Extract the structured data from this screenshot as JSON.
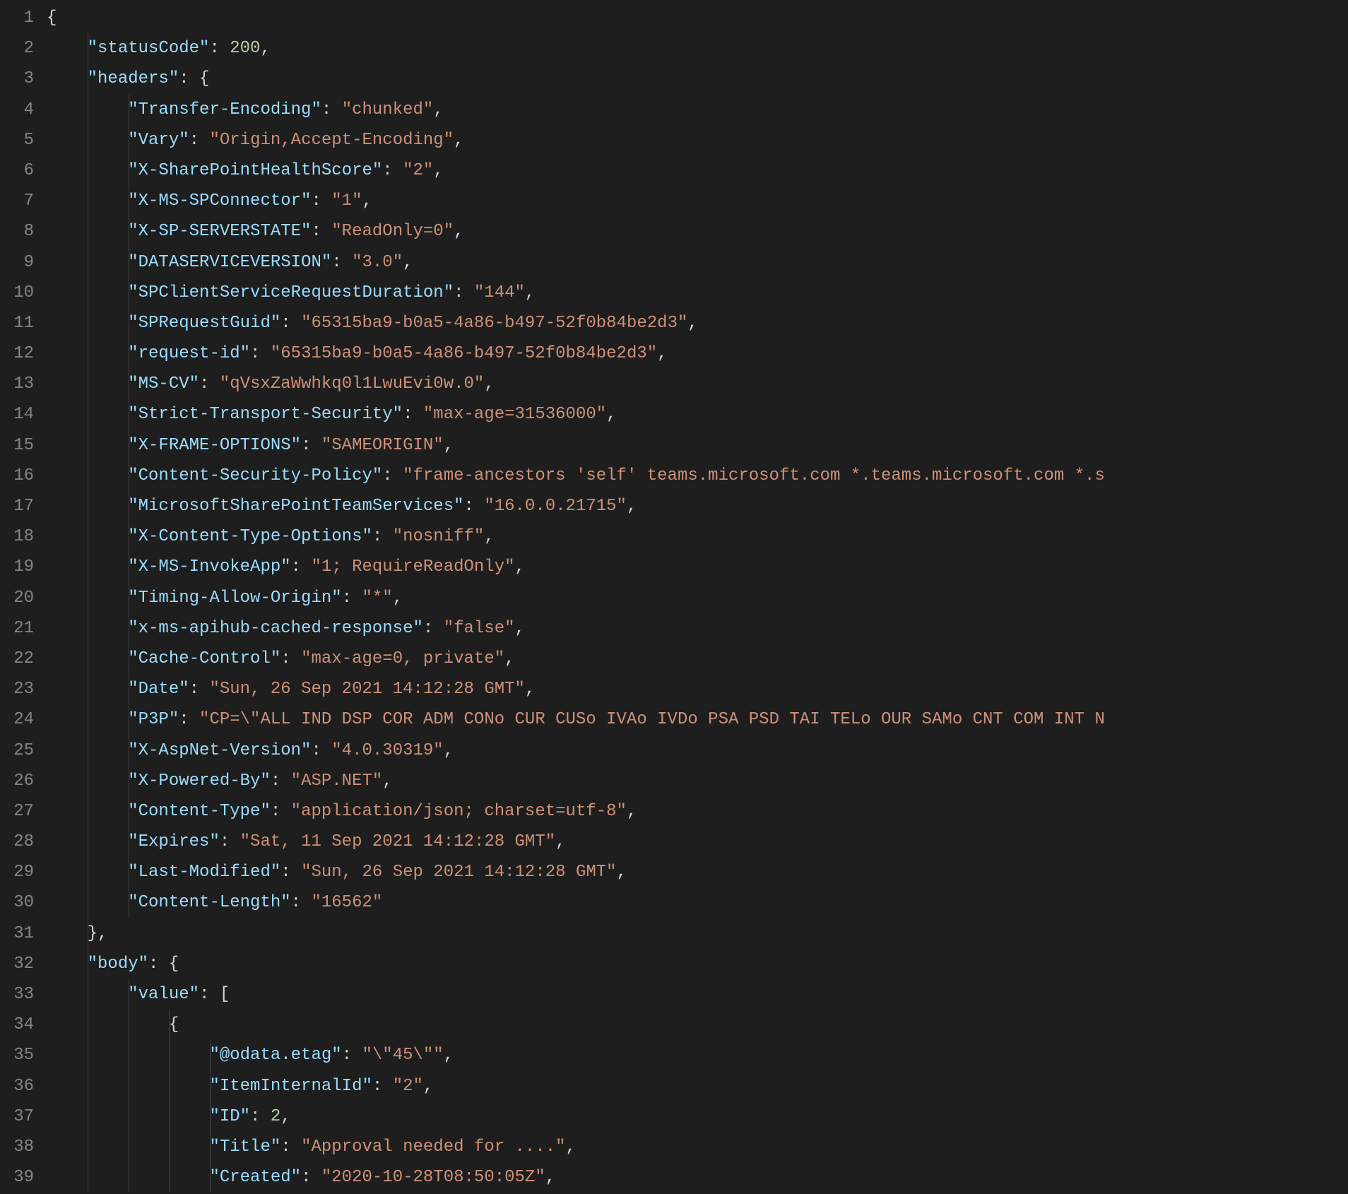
{
  "lines": [
    {
      "n": 1,
      "indent": 0,
      "guides": [],
      "tokens": [
        {
          "t": "brace",
          "v": "{"
        }
      ]
    },
    {
      "n": 2,
      "indent": 1,
      "guides": [
        1
      ],
      "tokens": [
        {
          "t": "key",
          "v": "\"statusCode\""
        },
        {
          "t": "punct",
          "v": ": "
        },
        {
          "t": "num",
          "v": "200"
        },
        {
          "t": "punct",
          "v": ","
        }
      ]
    },
    {
      "n": 3,
      "indent": 1,
      "guides": [
        1
      ],
      "tokens": [
        {
          "t": "key",
          "v": "\"headers\""
        },
        {
          "t": "punct",
          "v": ": "
        },
        {
          "t": "brace",
          "v": "{"
        }
      ]
    },
    {
      "n": 4,
      "indent": 2,
      "guides": [
        1,
        2
      ],
      "tokens": [
        {
          "t": "key",
          "v": "\"Transfer-Encoding\""
        },
        {
          "t": "punct",
          "v": ": "
        },
        {
          "t": "str",
          "v": "\"chunked\""
        },
        {
          "t": "punct",
          "v": ","
        }
      ]
    },
    {
      "n": 5,
      "indent": 2,
      "guides": [
        1,
        2
      ],
      "tokens": [
        {
          "t": "key",
          "v": "\"Vary\""
        },
        {
          "t": "punct",
          "v": ": "
        },
        {
          "t": "str",
          "v": "\"Origin,Accept-Encoding\""
        },
        {
          "t": "punct",
          "v": ","
        }
      ]
    },
    {
      "n": 6,
      "indent": 2,
      "guides": [
        1,
        2
      ],
      "tokens": [
        {
          "t": "key",
          "v": "\"X-SharePointHealthScore\""
        },
        {
          "t": "punct",
          "v": ": "
        },
        {
          "t": "str",
          "v": "\"2\""
        },
        {
          "t": "punct",
          "v": ","
        }
      ]
    },
    {
      "n": 7,
      "indent": 2,
      "guides": [
        1,
        2
      ],
      "tokens": [
        {
          "t": "key",
          "v": "\"X-MS-SPConnector\""
        },
        {
          "t": "punct",
          "v": ": "
        },
        {
          "t": "str",
          "v": "\"1\""
        },
        {
          "t": "punct",
          "v": ","
        }
      ]
    },
    {
      "n": 8,
      "indent": 2,
      "guides": [
        1,
        2
      ],
      "tokens": [
        {
          "t": "key",
          "v": "\"X-SP-SERVERSTATE\""
        },
        {
          "t": "punct",
          "v": ": "
        },
        {
          "t": "str",
          "v": "\"ReadOnly=0\""
        },
        {
          "t": "punct",
          "v": ","
        }
      ]
    },
    {
      "n": 9,
      "indent": 2,
      "guides": [
        1,
        2
      ],
      "tokens": [
        {
          "t": "key",
          "v": "\"DATASERVICEVERSION\""
        },
        {
          "t": "punct",
          "v": ": "
        },
        {
          "t": "str",
          "v": "\"3.0\""
        },
        {
          "t": "punct",
          "v": ","
        }
      ]
    },
    {
      "n": 10,
      "indent": 2,
      "guides": [
        1,
        2
      ],
      "tokens": [
        {
          "t": "key",
          "v": "\"SPClientServiceRequestDuration\""
        },
        {
          "t": "punct",
          "v": ": "
        },
        {
          "t": "str",
          "v": "\"144\""
        },
        {
          "t": "punct",
          "v": ","
        }
      ]
    },
    {
      "n": 11,
      "indent": 2,
      "guides": [
        1,
        2
      ],
      "tokens": [
        {
          "t": "key",
          "v": "\"SPRequestGuid\""
        },
        {
          "t": "punct",
          "v": ": "
        },
        {
          "t": "str",
          "v": "\"65315ba9-b0a5-4a86-b497-52f0b84be2d3\""
        },
        {
          "t": "punct",
          "v": ","
        }
      ]
    },
    {
      "n": 12,
      "indent": 2,
      "guides": [
        1,
        2
      ],
      "tokens": [
        {
          "t": "key",
          "v": "\"request-id\""
        },
        {
          "t": "punct",
          "v": ": "
        },
        {
          "t": "str",
          "v": "\"65315ba9-b0a5-4a86-b497-52f0b84be2d3\""
        },
        {
          "t": "punct",
          "v": ","
        }
      ]
    },
    {
      "n": 13,
      "indent": 2,
      "guides": [
        1,
        2
      ],
      "tokens": [
        {
          "t": "key",
          "v": "\"MS-CV\""
        },
        {
          "t": "punct",
          "v": ": "
        },
        {
          "t": "str",
          "v": "\"qVsxZaWwhkq0l1LwuEvi0w.0\""
        },
        {
          "t": "punct",
          "v": ","
        }
      ]
    },
    {
      "n": 14,
      "indent": 2,
      "guides": [
        1,
        2
      ],
      "tokens": [
        {
          "t": "key",
          "v": "\"Strict-Transport-Security\""
        },
        {
          "t": "punct",
          "v": ": "
        },
        {
          "t": "str",
          "v": "\"max-age=31536000\""
        },
        {
          "t": "punct",
          "v": ","
        }
      ]
    },
    {
      "n": 15,
      "indent": 2,
      "guides": [
        1,
        2
      ],
      "tokens": [
        {
          "t": "key",
          "v": "\"X-FRAME-OPTIONS\""
        },
        {
          "t": "punct",
          "v": ": "
        },
        {
          "t": "str",
          "v": "\"SAMEORIGIN\""
        },
        {
          "t": "punct",
          "v": ","
        }
      ]
    },
    {
      "n": 16,
      "indent": 2,
      "guides": [
        1,
        2
      ],
      "tokens": [
        {
          "t": "key",
          "v": "\"Content-Security-Policy\""
        },
        {
          "t": "punct",
          "v": ": "
        },
        {
          "t": "str",
          "v": "\"frame-ancestors 'self' teams.microsoft.com *.teams.microsoft.com *.s"
        }
      ]
    },
    {
      "n": 17,
      "indent": 2,
      "guides": [
        1,
        2
      ],
      "tokens": [
        {
          "t": "key",
          "v": "\"MicrosoftSharePointTeamServices\""
        },
        {
          "t": "punct",
          "v": ": "
        },
        {
          "t": "str",
          "v": "\"16.0.0.21715\""
        },
        {
          "t": "punct",
          "v": ","
        }
      ]
    },
    {
      "n": 18,
      "indent": 2,
      "guides": [
        1,
        2
      ],
      "tokens": [
        {
          "t": "key",
          "v": "\"X-Content-Type-Options\""
        },
        {
          "t": "punct",
          "v": ": "
        },
        {
          "t": "str",
          "v": "\"nosniff\""
        },
        {
          "t": "punct",
          "v": ","
        }
      ]
    },
    {
      "n": 19,
      "indent": 2,
      "guides": [
        1,
        2
      ],
      "tokens": [
        {
          "t": "key",
          "v": "\"X-MS-InvokeApp\""
        },
        {
          "t": "punct",
          "v": ": "
        },
        {
          "t": "str",
          "v": "\"1; RequireReadOnly\""
        },
        {
          "t": "punct",
          "v": ","
        }
      ]
    },
    {
      "n": 20,
      "indent": 2,
      "guides": [
        1,
        2
      ],
      "tokens": [
        {
          "t": "key",
          "v": "\"Timing-Allow-Origin\""
        },
        {
          "t": "punct",
          "v": ": "
        },
        {
          "t": "str",
          "v": "\"*\""
        },
        {
          "t": "punct",
          "v": ","
        }
      ]
    },
    {
      "n": 21,
      "indent": 2,
      "guides": [
        1,
        2
      ],
      "tokens": [
        {
          "t": "key",
          "v": "\"x-ms-apihub-cached-response\""
        },
        {
          "t": "punct",
          "v": ": "
        },
        {
          "t": "str",
          "v": "\"false\""
        },
        {
          "t": "punct",
          "v": ","
        }
      ]
    },
    {
      "n": 22,
      "indent": 2,
      "guides": [
        1,
        2
      ],
      "tokens": [
        {
          "t": "key",
          "v": "\"Cache-Control\""
        },
        {
          "t": "punct",
          "v": ": "
        },
        {
          "t": "str",
          "v": "\"max-age=0, private\""
        },
        {
          "t": "punct",
          "v": ","
        }
      ]
    },
    {
      "n": 23,
      "indent": 2,
      "guides": [
        1,
        2
      ],
      "tokens": [
        {
          "t": "key",
          "v": "\"Date\""
        },
        {
          "t": "punct",
          "v": ": "
        },
        {
          "t": "str",
          "v": "\"Sun, 26 Sep 2021 14:12:28 GMT\""
        },
        {
          "t": "punct",
          "v": ","
        }
      ]
    },
    {
      "n": 24,
      "indent": 2,
      "guides": [
        1,
        2
      ],
      "tokens": [
        {
          "t": "key",
          "v": "\"P3P\""
        },
        {
          "t": "punct",
          "v": ": "
        },
        {
          "t": "str",
          "v": "\"CP=\\\"ALL IND DSP COR ADM CONo CUR CUSo IVAo IVDo PSA PSD TAI TELo OUR SAMo CNT COM INT N"
        }
      ]
    },
    {
      "n": 25,
      "indent": 2,
      "guides": [
        1,
        2
      ],
      "tokens": [
        {
          "t": "key",
          "v": "\"X-AspNet-Version\""
        },
        {
          "t": "punct",
          "v": ": "
        },
        {
          "t": "str",
          "v": "\"4.0.30319\""
        },
        {
          "t": "punct",
          "v": ","
        }
      ]
    },
    {
      "n": 26,
      "indent": 2,
      "guides": [
        1,
        2
      ],
      "tokens": [
        {
          "t": "key",
          "v": "\"X-Powered-By\""
        },
        {
          "t": "punct",
          "v": ": "
        },
        {
          "t": "str",
          "v": "\"ASP.NET\""
        },
        {
          "t": "punct",
          "v": ","
        }
      ]
    },
    {
      "n": 27,
      "indent": 2,
      "guides": [
        1,
        2
      ],
      "tokens": [
        {
          "t": "key",
          "v": "\"Content-Type\""
        },
        {
          "t": "punct",
          "v": ": "
        },
        {
          "t": "str",
          "v": "\"application/json; charset=utf-8\""
        },
        {
          "t": "punct",
          "v": ","
        }
      ]
    },
    {
      "n": 28,
      "indent": 2,
      "guides": [
        1,
        2
      ],
      "tokens": [
        {
          "t": "key",
          "v": "\"Expires\""
        },
        {
          "t": "punct",
          "v": ": "
        },
        {
          "t": "str",
          "v": "\"Sat, 11 Sep 2021 14:12:28 GMT\""
        },
        {
          "t": "punct",
          "v": ","
        }
      ]
    },
    {
      "n": 29,
      "indent": 2,
      "guides": [
        1,
        2
      ],
      "tokens": [
        {
          "t": "key",
          "v": "\"Last-Modified\""
        },
        {
          "t": "punct",
          "v": ": "
        },
        {
          "t": "str",
          "v": "\"Sun, 26 Sep 2021 14:12:28 GMT\""
        },
        {
          "t": "punct",
          "v": ","
        }
      ]
    },
    {
      "n": 30,
      "indent": 2,
      "guides": [
        1,
        2
      ],
      "tokens": [
        {
          "t": "key",
          "v": "\"Content-Length\""
        },
        {
          "t": "punct",
          "v": ": "
        },
        {
          "t": "str",
          "v": "\"16562\""
        }
      ]
    },
    {
      "n": 31,
      "indent": 1,
      "guides": [
        1
      ],
      "tokens": [
        {
          "t": "brace",
          "v": "}"
        },
        {
          "t": "punct",
          "v": ","
        }
      ]
    },
    {
      "n": 32,
      "indent": 1,
      "guides": [
        1
      ],
      "tokens": [
        {
          "t": "key",
          "v": "\"body\""
        },
        {
          "t": "punct",
          "v": ": "
        },
        {
          "t": "brace",
          "v": "{"
        }
      ]
    },
    {
      "n": 33,
      "indent": 2,
      "guides": [
        1,
        2
      ],
      "tokens": [
        {
          "t": "key",
          "v": "\"value\""
        },
        {
          "t": "punct",
          "v": ": "
        },
        {
          "t": "brace",
          "v": "["
        }
      ]
    },
    {
      "n": 34,
      "indent": 3,
      "guides": [
        1,
        2,
        3
      ],
      "tokens": [
        {
          "t": "brace",
          "v": "{"
        }
      ]
    },
    {
      "n": 35,
      "indent": 4,
      "guides": [
        1,
        2,
        3,
        4
      ],
      "tokens": [
        {
          "t": "key",
          "v": "\"@odata.etag\""
        },
        {
          "t": "punct",
          "v": ": "
        },
        {
          "t": "str",
          "v": "\"\\\"45\\\"\""
        },
        {
          "t": "punct",
          "v": ","
        }
      ]
    },
    {
      "n": 36,
      "indent": 4,
      "guides": [
        1,
        2,
        3,
        4
      ],
      "tokens": [
        {
          "t": "key",
          "v": "\"ItemInternalId\""
        },
        {
          "t": "punct",
          "v": ": "
        },
        {
          "t": "str",
          "v": "\"2\""
        },
        {
          "t": "punct",
          "v": ","
        }
      ]
    },
    {
      "n": 37,
      "indent": 4,
      "guides": [
        1,
        2,
        3,
        4
      ],
      "tokens": [
        {
          "t": "key",
          "v": "\"ID\""
        },
        {
          "t": "punct",
          "v": ": "
        },
        {
          "t": "num",
          "v": "2"
        },
        {
          "t": "punct",
          "v": ","
        }
      ]
    },
    {
      "n": 38,
      "indent": 4,
      "guides": [
        1,
        2,
        3,
        4
      ],
      "tokens": [
        {
          "t": "key",
          "v": "\"Title\""
        },
        {
          "t": "punct",
          "v": ": "
        },
        {
          "t": "str",
          "v": "\"Approval needed for ....\""
        },
        {
          "t": "punct",
          "v": ","
        }
      ]
    },
    {
      "n": 39,
      "indent": 4,
      "guides": [
        1,
        2,
        3,
        4
      ],
      "tokens": [
        {
          "t": "key",
          "v": "\"Created\""
        },
        {
          "t": "punct",
          "v": ": "
        },
        {
          "t": "str",
          "v": "\"2020-10-28T08:50:05Z\""
        },
        {
          "t": "punct",
          "v": ","
        }
      ]
    }
  ],
  "indentSpaces": 4,
  "charWidth": 14.45
}
